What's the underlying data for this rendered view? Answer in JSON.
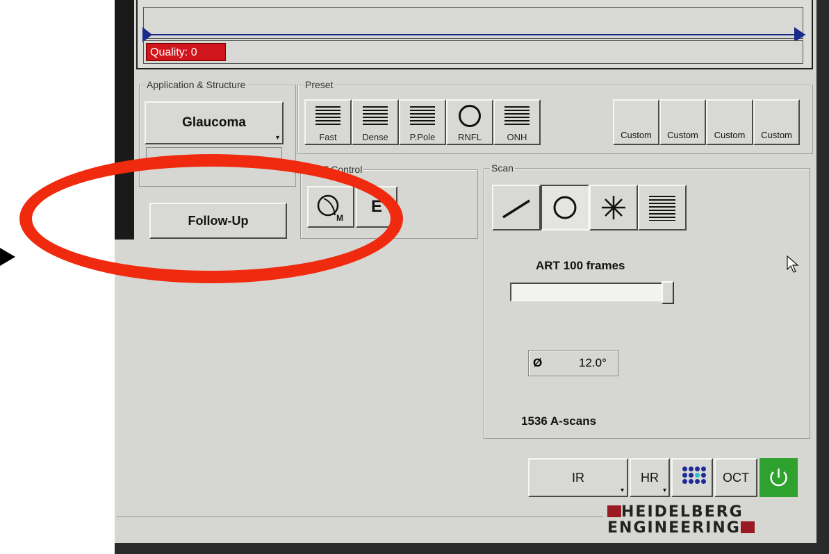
{
  "quality": {
    "label": "Quality: 0",
    "color": "#d0161c"
  },
  "groups": {
    "application": "Application & Structure",
    "preset": "Preset",
    "oct_control": "OCT Control",
    "scan": "Scan"
  },
  "application": {
    "primary": "Glaucoma",
    "followup": "Follow-Up"
  },
  "presets": [
    {
      "label": "Fast",
      "icon": "horizontal-lines-icon"
    },
    {
      "label": "Dense",
      "icon": "horizontal-lines-icon"
    },
    {
      "label": "P.Pole",
      "icon": "horizontal-lines-icon"
    },
    {
      "label": "RNFL",
      "icon": "circle-icon"
    },
    {
      "label": "ONH",
      "icon": "horizontal-lines-icon"
    }
  ],
  "custom_presets": [
    "Custom",
    "Custom",
    "Custom",
    "Custom"
  ],
  "scan": {
    "patterns": [
      "line-scan-icon",
      "circle-scan-icon",
      "star-scan-icon",
      "raster-scan-icon"
    ],
    "selected": "circle-scan-icon",
    "art_label": "ART 100 frames",
    "art_level": 0.95,
    "diameter_symbol": "Ø",
    "diameter_value": "12.0°",
    "ascans": "1536 A-scans"
  },
  "bottom": {
    "ir": "IR",
    "hr": "HR",
    "oct": "OCT",
    "power_color": "#2ea12e"
  },
  "logo": {
    "line1": "HEIDELBERG",
    "line2": "ENGINEERING",
    "accent": "#9a1a22"
  },
  "annotation": {
    "color": "#f02a0e"
  }
}
